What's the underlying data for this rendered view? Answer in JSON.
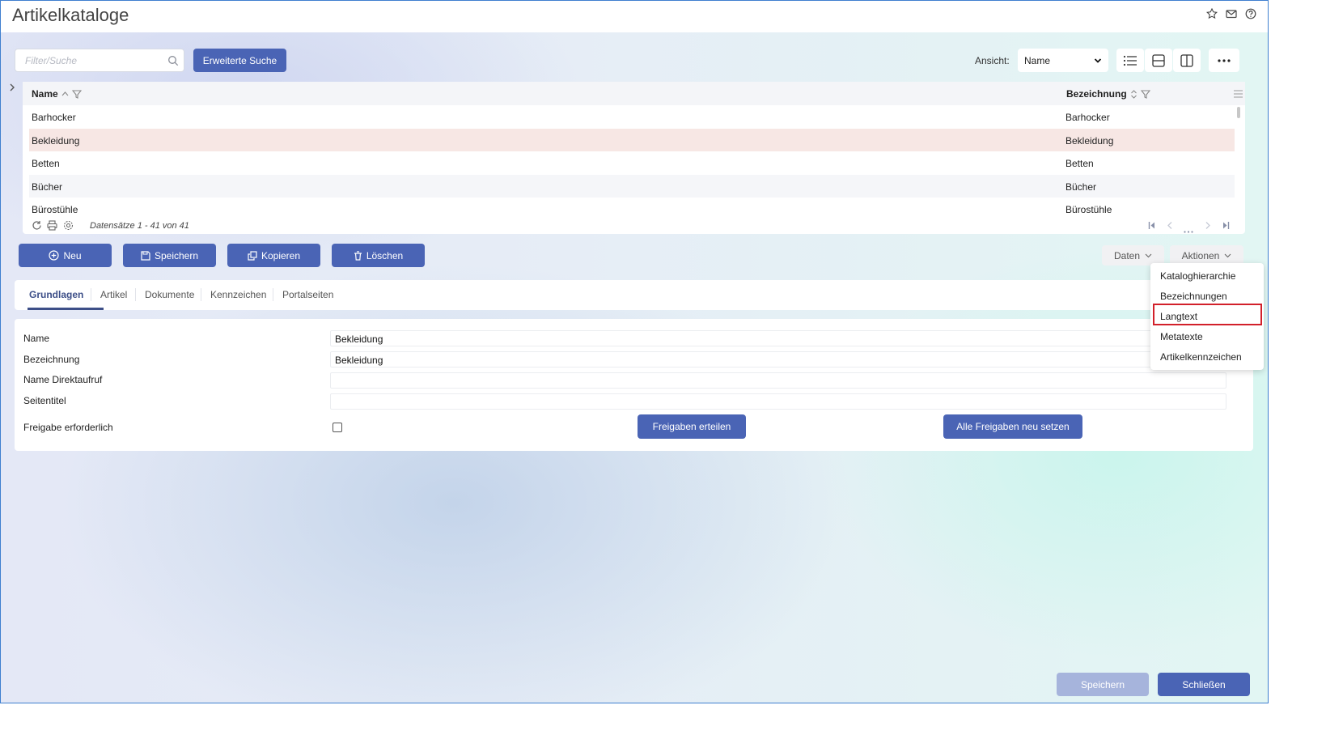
{
  "window": {
    "title": "Artikelkataloge"
  },
  "search": {
    "placeholder": "Filter/Suche",
    "value": ""
  },
  "toolbar": {
    "extended_search": "Erweiterte Suche",
    "view_label": "Ansicht:",
    "view_value": "Name",
    "view_options": [
      "Name"
    ]
  },
  "grid": {
    "columns": [
      "Name",
      "Bezeichnung"
    ],
    "rows": [
      {
        "name": "Barhocker",
        "bezeichnung": "Barhocker"
      },
      {
        "name": "Bekleidung",
        "bezeichnung": "Bekleidung"
      },
      {
        "name": "Betten",
        "bezeichnung": "Betten"
      },
      {
        "name": "Bücher",
        "bezeichnung": "Bücher"
      },
      {
        "name": "Bürostühle",
        "bezeichnung": "Bürostühle"
      }
    ],
    "records": "Datensätze 1 - 41 von 41"
  },
  "actions": {
    "new": "Neu",
    "save": "Speichern",
    "copy": "Kopieren",
    "delete": "Löschen",
    "data_menu": "Daten",
    "actions_menu": "Aktionen"
  },
  "dropdown": {
    "items": [
      "Kataloghierarchie",
      "Bezeichnungen",
      "Langtext",
      "Metatexte",
      "Artikelkennzeichen"
    ]
  },
  "tabs": [
    "Grundlagen",
    "Artikel",
    "Dokumente",
    "Kennzeichen",
    "Portalseiten"
  ],
  "form": {
    "name_label": "Name",
    "name_value": "Bekleidung",
    "bezeichnung_label": "Bezeichnung",
    "bezeichnung_value": "Bekleidung",
    "direktaufruf_label": "Name Direktaufruf",
    "direktaufruf_value": "",
    "seitentitel_label": "Seitentitel",
    "seitentitel_value": "",
    "freigabe_label": "Freigabe erforderlich",
    "freigabe_checked": false,
    "freigaben_erteilen": "Freigaben erteilen",
    "alle_freigaben": "Alle Freigaben neu setzen"
  },
  "footer": {
    "save": "Speichern",
    "close": "Schließen"
  },
  "colors": {
    "primary": "#4a64b5",
    "selected_row": "#f7e7e4",
    "highlight_border": "#d2202a"
  }
}
